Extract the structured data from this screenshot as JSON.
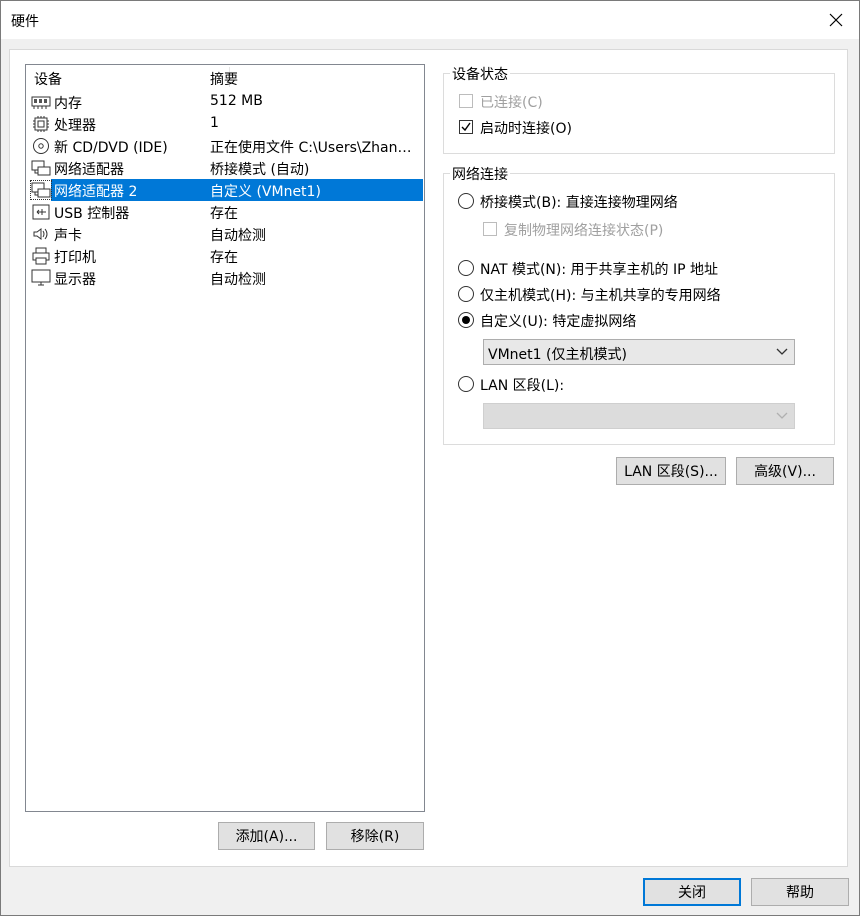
{
  "window": {
    "title": "硬件"
  },
  "device_list": {
    "header": {
      "device": "设备",
      "summary": "摘要"
    },
    "items": [
      {
        "icon": "memory-icon",
        "name": "内存",
        "summary": "512 MB",
        "selected": false
      },
      {
        "icon": "processor-icon",
        "name": "处理器",
        "summary": "1",
        "selected": false
      },
      {
        "icon": "cd-dvd-icon",
        "name": "新 CD/DVD (IDE)",
        "summary": "正在使用文件 C:\\Users\\Zhan…",
        "selected": false
      },
      {
        "icon": "network-adapter-icon",
        "name": "网络适配器",
        "summary": "桥接模式 (自动)",
        "selected": false
      },
      {
        "icon": "network-adapter-icon",
        "name": "网络适配器 2",
        "summary": "自定义 (VMnet1)",
        "selected": true
      },
      {
        "icon": "usb-icon",
        "name": "USB 控制器",
        "summary": "存在",
        "selected": false
      },
      {
        "icon": "sound-card-icon",
        "name": "声卡",
        "summary": "自动检测",
        "selected": false
      },
      {
        "icon": "printer-icon",
        "name": "打印机",
        "summary": "存在",
        "selected": false
      },
      {
        "icon": "display-icon",
        "name": "显示器",
        "summary": "自动检测",
        "selected": false
      }
    ]
  },
  "list_buttons": {
    "add": "添加(A)...",
    "remove": "移除(R)"
  },
  "device_status": {
    "title": "设备状态",
    "connected": {
      "label": "已连接(C)",
      "checked": false,
      "disabled": true
    },
    "connect_at_power_on": {
      "label": "启动时连接(O)",
      "checked": true,
      "disabled": false
    }
  },
  "network_connection": {
    "title": "网络连接",
    "bridged": {
      "label": "桥接模式(B): 直接连接物理网络",
      "selected": false
    },
    "replicate_state": {
      "label": "复制物理网络连接状态(P)",
      "checked": false,
      "disabled": true
    },
    "nat": {
      "label": "NAT 模式(N): 用于共享主机的 IP 地址",
      "selected": false
    },
    "host_only": {
      "label": "仅主机模式(H): 与主机共享的专用网络",
      "selected": false
    },
    "custom": {
      "label": "自定义(U): 特定虚拟网络",
      "selected": true
    },
    "custom_select": {
      "value": "VMnet1 (仅主机模式)"
    },
    "lan_segment": {
      "label": "LAN 区段(L):",
      "selected": false
    },
    "lan_select": {
      "value": ""
    }
  },
  "panel_buttons": {
    "lan_segments": "LAN 区段(S)...",
    "advanced": "高级(V)..."
  },
  "footer_buttons": {
    "close": "关闭",
    "help": "帮助"
  },
  "colors": {
    "selection": "#0078d7",
    "default_button_border": "#0078d7"
  }
}
